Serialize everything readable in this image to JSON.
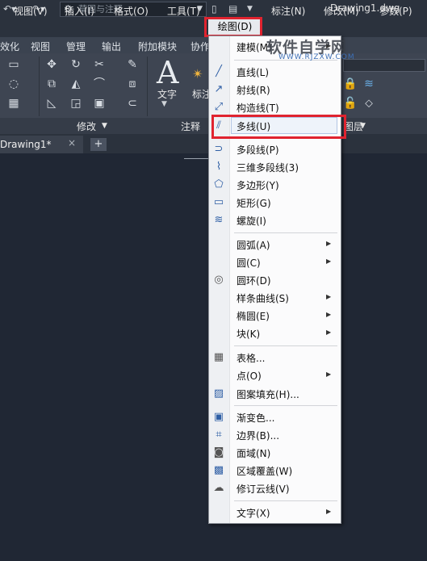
{
  "title_bar": {
    "workspace": "草图与注释",
    "doc_title": "Drawing1.dwg"
  },
  "menubar": {
    "items": [
      "视图(V)",
      "插入(I)",
      "格式(O)",
      "工具(T)",
      "绘图(D)",
      "标注(N)",
      "修改(M)",
      "参数(P)"
    ]
  },
  "ribbon_tabs": [
    "效化",
    "视图",
    "管理",
    "输出",
    "附加模块",
    "协作"
  ],
  "ribbon": {
    "text_label": "文字",
    "dim_label": "标注",
    "panels": [
      "修改",
      "注释",
      "图层"
    ]
  },
  "doc_tabs": {
    "active": "Drawing1*",
    "close": "×",
    "add": "+"
  },
  "dropdown": {
    "items": [
      {
        "label": "建模(M)",
        "icon": "none",
        "submenu": true
      },
      {
        "label": "直线(L)",
        "icon": "line-icon"
      },
      {
        "label": "射线(R)",
        "icon": "ray-icon"
      },
      {
        "label": "构造线(T)",
        "icon": "xline-icon"
      },
      {
        "label": "多线(U)",
        "icon": "mline-icon"
      },
      {
        "label": "多段线(P)",
        "icon": "pline-icon"
      },
      {
        "label": "三维多段线(3)",
        "icon": "3dpoly-icon"
      },
      {
        "label": "多边形(Y)",
        "icon": "polygon-icon"
      },
      {
        "label": "矩形(G)",
        "icon": "rectangle-icon"
      },
      {
        "label": "螺旋(I)",
        "icon": "helix-icon"
      },
      {
        "label": "圆弧(A)",
        "icon": "none",
        "submenu": true
      },
      {
        "label": "圆(C)",
        "icon": "none",
        "submenu": true
      },
      {
        "label": "圆环(D)",
        "icon": "donut-icon"
      },
      {
        "label": "样条曲线(S)",
        "icon": "none",
        "submenu": true
      },
      {
        "label": "椭圆(E)",
        "icon": "none",
        "submenu": true
      },
      {
        "label": "块(K)",
        "icon": "none",
        "submenu": true
      },
      {
        "label": "表格...",
        "icon": "table-icon"
      },
      {
        "label": "点(O)",
        "icon": "none",
        "submenu": true
      },
      {
        "label": "图案填充(H)...",
        "icon": "hatch-icon"
      },
      {
        "label": "渐变色...",
        "icon": "gradient-icon"
      },
      {
        "label": "边界(B)...",
        "icon": "boundary-icon"
      },
      {
        "label": "面域(N)",
        "icon": "region-icon"
      },
      {
        "label": "区域覆盖(W)",
        "icon": "wipeout-icon"
      },
      {
        "label": "修订云线(V)",
        "icon": "revcloud-icon"
      },
      {
        "label": "文字(X)",
        "icon": "none",
        "submenu": true
      }
    ]
  },
  "watermark": {
    "main": "软件自学网",
    "sub": "WWW.RJZXW.COM"
  },
  "colors": {
    "highlight": "#e0232f",
    "accent": "#2f5fa5"
  }
}
